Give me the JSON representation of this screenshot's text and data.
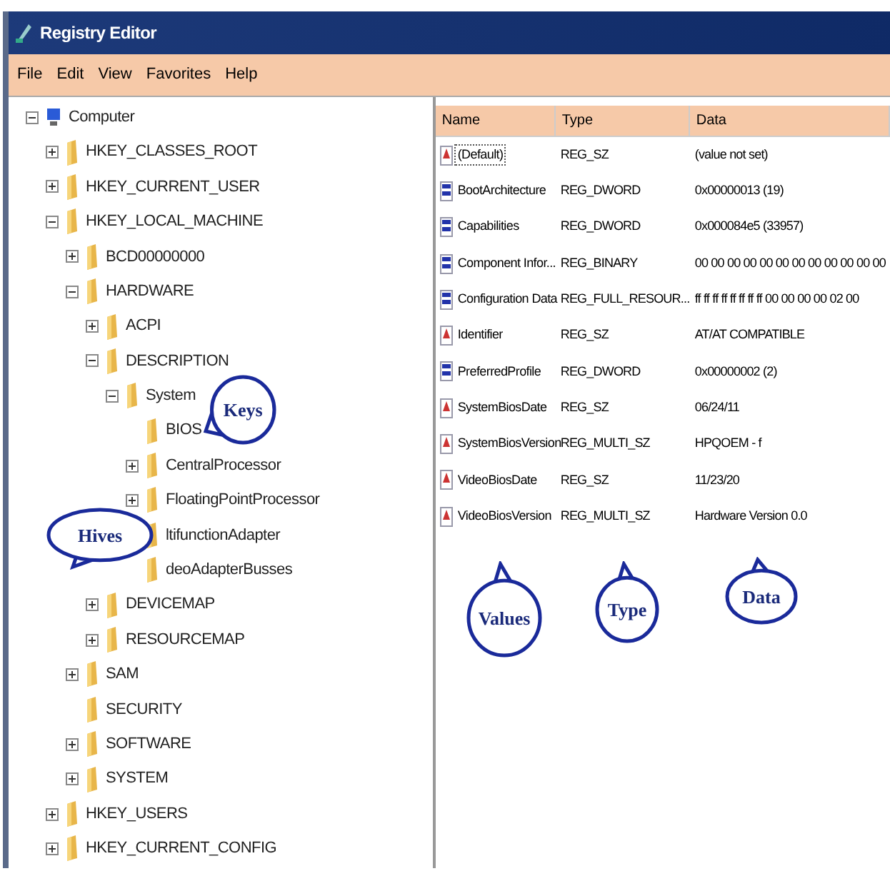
{
  "window": {
    "title": "Registry Editor"
  },
  "menu": [
    "File",
    "Edit",
    "View",
    "Favorites",
    "Help"
  ],
  "tree": [
    {
      "label": "Computer",
      "kind": "computer",
      "expanded": true,
      "children": [
        {
          "label": "HKEY_CLASSES_ROOT",
          "expanded": false
        },
        {
          "label": "HKEY_CURRENT_USER",
          "expanded": false
        },
        {
          "label": "HKEY_LOCAL_MACHINE",
          "expanded": true,
          "children": [
            {
              "label": "BCD00000000",
              "expanded": false
            },
            {
              "label": "HARDWARE",
              "expanded": true,
              "children": [
                {
                  "label": "ACPI",
                  "expanded": false
                },
                {
                  "label": "DESCRIPTION",
                  "expanded": true,
                  "children": [
                    {
                      "label": "System",
                      "expanded": true,
                      "children": [
                        {
                          "label": "BIOS"
                        },
                        {
                          "label": "CentralProcessor",
                          "expanded": false
                        },
                        {
                          "label": "FloatingPointProcessor",
                          "expanded": false
                        },
                        {
                          "label": "ltifunctionAdapter"
                        },
                        {
                          "label": "deoAdapterBusses"
                        }
                      ]
                    }
                  ]
                },
                {
                  "label": "DEVICEMAP",
                  "expanded": false
                },
                {
                  "label": "RESOURCEMAP",
                  "expanded": false
                }
              ]
            },
            {
              "label": "SAM",
              "expanded": false
            },
            {
              "label": "SECURITY"
            },
            {
              "label": "SOFTWARE",
              "expanded": false
            },
            {
              "label": "SYSTEM",
              "expanded": false
            }
          ]
        },
        {
          "label": "HKEY_USERS",
          "expanded": false
        },
        {
          "label": "HKEY_CURRENT_CONFIG",
          "expanded": false
        }
      ]
    }
  ],
  "values": {
    "columns": [
      "Name",
      "Type",
      "Data"
    ],
    "rows": [
      {
        "kind": "string",
        "name": "(Default)",
        "type": "REG_SZ",
        "data": "(value not set)",
        "selected": true
      },
      {
        "kind": "binary",
        "name": "BootArchitecture",
        "type": "REG_DWORD",
        "data": "0x00000013 (19)",
        "selected": false
      },
      {
        "kind": "binary",
        "name": "Capabilities",
        "type": "REG_DWORD",
        "data": "0x000084e5 (33957)",
        "selected": false
      },
      {
        "kind": "binary",
        "name": "Component Infor...",
        "type": "REG_BINARY",
        "data": "00 00 00 00 00 00 00 00 00 00 00 00",
        "selected": false
      },
      {
        "kind": "binary",
        "name": "Configuration Data",
        "type": "REG_FULL_RESOUR...",
        "data": "ff ff ff ff ff ff ff ff 00 00 00 00 02 00",
        "selected": false
      },
      {
        "kind": "string",
        "name": "Identifier",
        "type": "REG_SZ",
        "data": "AT/AT COMPATIBLE",
        "selected": false
      },
      {
        "kind": "binary",
        "name": "PreferredProfile",
        "type": "REG_DWORD",
        "data": "0x00000002 (2)",
        "selected": false
      },
      {
        "kind": "string",
        "name": "SystemBiosDate",
        "type": "REG_SZ",
        "data": "06/24/11",
        "selected": false
      },
      {
        "kind": "string",
        "name": "SystemBiosVersion",
        "type": "REG_MULTI_SZ",
        "data": "HPQOEM - f",
        "selected": false
      },
      {
        "kind": "string",
        "name": "VideoBiosDate",
        "type": "REG_SZ",
        "data": "11/23/20",
        "selected": false
      },
      {
        "kind": "string",
        "name": "VideoBiosVersion",
        "type": "REG_MULTI_SZ",
        "data": "Hardware Version 0.0",
        "selected": false
      }
    ]
  },
  "callouts": [
    {
      "text": "Keys"
    },
    {
      "text": "Hives"
    },
    {
      "text": "Values"
    },
    {
      "text": "Type"
    },
    {
      "text": "Data"
    }
  ]
}
